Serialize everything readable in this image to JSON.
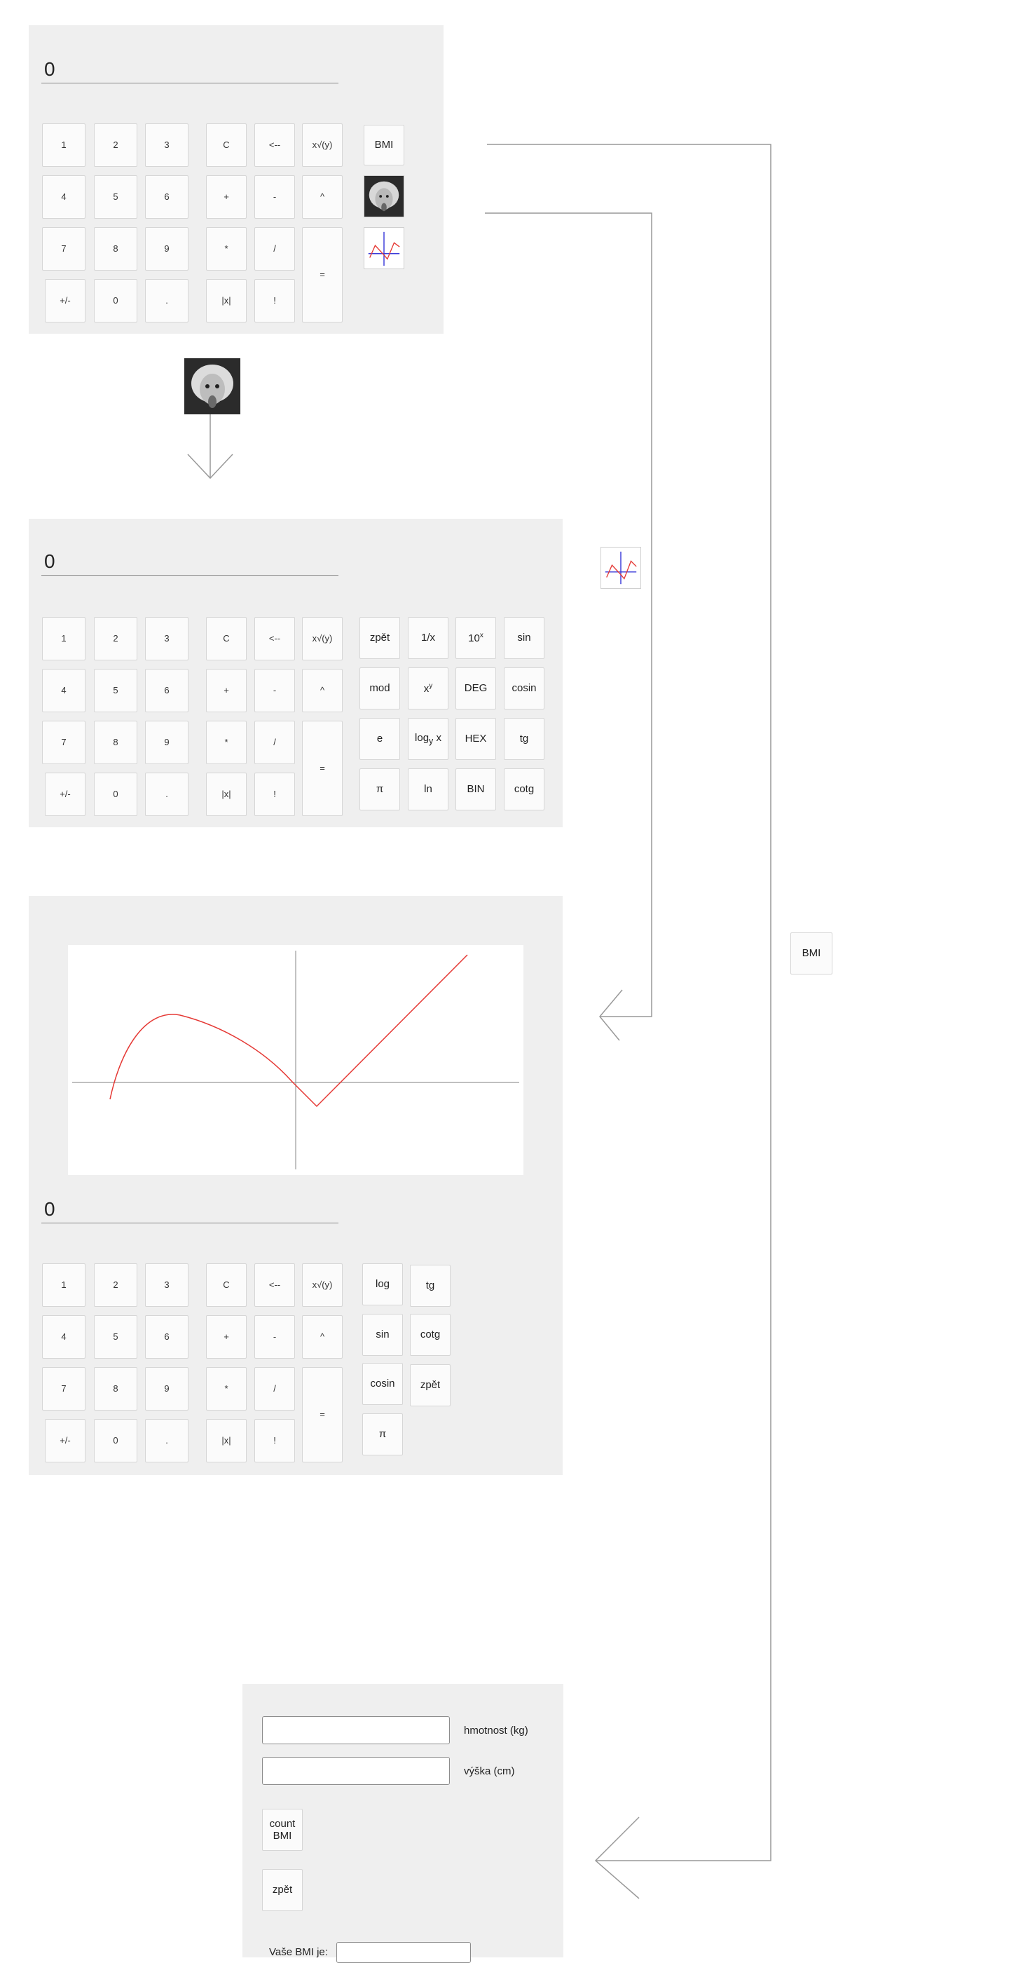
{
  "keypad": {
    "digits": [
      "1",
      "2",
      "3",
      "4",
      "5",
      "6",
      "7",
      "8",
      "9"
    ],
    "clear": "C",
    "backspace": "<--",
    "root": "x√(y)",
    "plus": "+",
    "minus": "-",
    "power": "^",
    "multiply": "*",
    "divide": "/",
    "equals": "=",
    "sign": "+/-",
    "zero": "0",
    "dot": ".",
    "abs": "|x|",
    "factorial": "!"
  },
  "basic": {
    "display": "0",
    "bmi_button": "BMI",
    "einstein_icon": "einstein-icon",
    "graph_icon": "graph-icon"
  },
  "scientific": {
    "display": "0",
    "functions": [
      "zpět",
      "1/x",
      "10^x",
      "sin",
      "mod",
      "x^y",
      "DEG",
      "cosin",
      "e",
      "log_y x",
      "HEX",
      "tg",
      "π",
      "ln",
      "BIN",
      "cotg"
    ]
  },
  "graphing": {
    "display": "0",
    "functions": [
      "log",
      "tg",
      "sin",
      "cotg",
      "cosin",
      "zpět",
      "π"
    ]
  },
  "bmi": {
    "weight_label": "hmotnost (kg)",
    "height_label": "výška (cm)",
    "weight_value": "",
    "height_value": "",
    "count_button": "count BMI",
    "back_button": "zpět",
    "result_label": "Vaše BMI je:",
    "result_value": ""
  },
  "flow": {
    "bmi_arrow_label": "BMI",
    "einstein_arrow_icon": "einstein-icon",
    "graph_arrow_icon": "graph-icon"
  },
  "colors": {
    "panel": "#efefef",
    "curve": "#e53935",
    "axis": "#9a9a9a",
    "graph_icon_vertical": "#3b3bd9",
    "graph_icon_curve": "#e53935"
  }
}
